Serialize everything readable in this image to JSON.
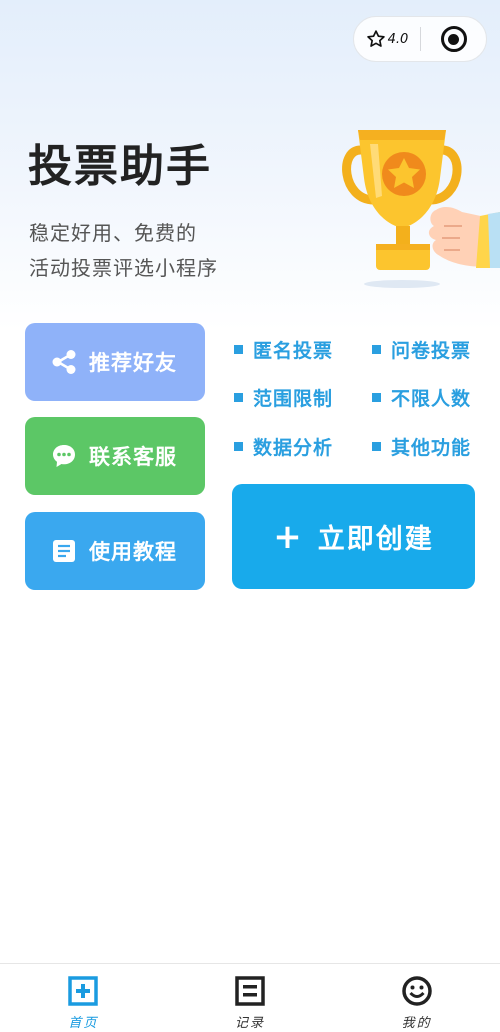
{
  "capsule": {
    "rating": "4.0",
    "rating_icon": "star-outline-icon",
    "menu_icon": "target-icon"
  },
  "header": {
    "title": "投票助手",
    "subtitle_line1": "稳定好用、免费的",
    "subtitle_line2": "活动投票评选小程序",
    "illustration": "trophy-hand-illustration"
  },
  "actions": {
    "share": {
      "label": "推荐好友",
      "icon": "share-icon",
      "color": "#8fb2f9"
    },
    "service": {
      "label": "联系客服",
      "icon": "chat-bubble-icon",
      "color": "#5cc766"
    },
    "guide": {
      "label": "使用教程",
      "icon": "document-icon",
      "color": "#3aa8ef"
    }
  },
  "features": [
    "匿名投票",
    "问卷投票",
    "范围限制",
    "不限人数",
    "数据分析",
    "其他功能"
  ],
  "create": {
    "plus": "+",
    "label": "立即创建",
    "color": "#18aaeb"
  },
  "tabbar": {
    "tabs": [
      {
        "label": "首页",
        "icon": "home-plus-icon",
        "active": true
      },
      {
        "label": "记录",
        "icon": "record-icon",
        "active": false
      },
      {
        "label": "我的",
        "icon": "smiley-icon",
        "active": false
      }
    ],
    "active_color": "#1a9be0"
  }
}
